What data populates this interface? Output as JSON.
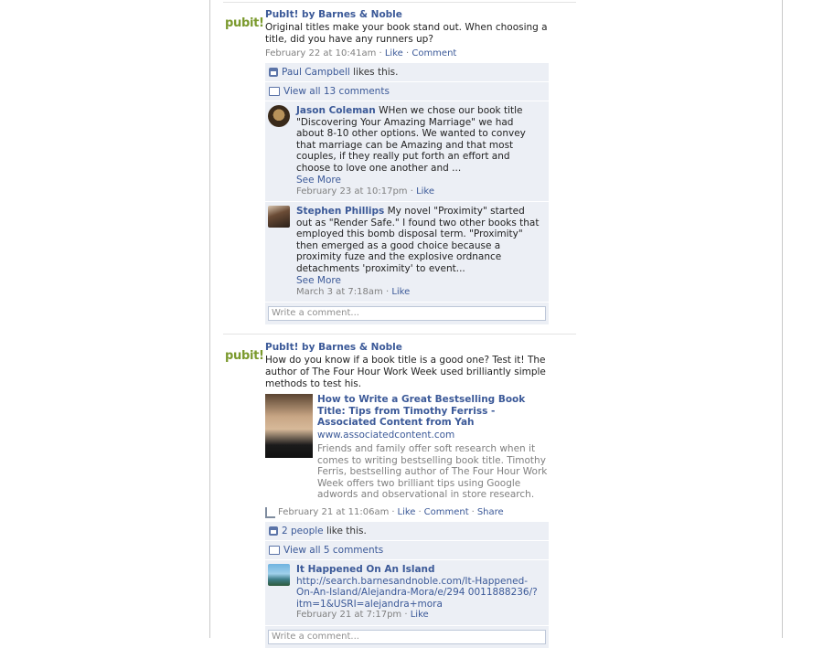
{
  "posts": [
    {
      "author": "PubIt! by Barnes & Noble",
      "logo_text": "pubit!",
      "message": "Original titles make your book stand out. When choosing a title, did you have any runners up?",
      "timestamp": "February 22 at 10:41am",
      "like_label": "Like",
      "comment_label": "Comment",
      "likes_name": "Paul Campbell",
      "likes_suffix": "likes this.",
      "view_all": "View all 13 comments",
      "comments": [
        {
          "name": "Jason Coleman",
          "text": "WHen we chose our book title \"Discovering Your Amazing Marriage\" we had about 8-10 other options. We wanted to convey that marriage can be Amazing and that most couples, if they really put forth an effort and choose to love one another and ...",
          "see_more": "See More",
          "time": "February 23 at 10:17pm",
          "like": "Like"
        },
        {
          "name": "Stephen Phillips",
          "text": "My novel \"Proximity\" started out as \"Render Safe.\" I found two other books that employed this bomb disposal term. \"Proximity\" then emerged as a good choice because a proximity fuze and the explosive ordnance detachments 'proximity' to event...",
          "see_more": "See More",
          "time": "March 3 at 7:18am",
          "like": "Like"
        }
      ],
      "write_placeholder": "Write a comment..."
    },
    {
      "author": "PubIt! by Barnes & Noble",
      "logo_text": "pubit!",
      "message": "How do you know if a book title is a good one? Test it! The author of The Four Hour Work Week used brilliantly simple methods to test his.",
      "attachment": {
        "title": "How to Write a Great Bestselling Book Title: Tips from Timothy Ferriss - Associated Content from Yah",
        "site": "www.associatedcontent.com",
        "description": "Friends and family offer soft research when it comes to writing bestselling book title. Timothy Ferris, bestselling author of The Four Hour Work Week offers two brilliant tips using Google adwords and observational in store research."
      },
      "timestamp": "February 21 at 11:06am",
      "like_label": "Like",
      "comment_label": "Comment",
      "share_label": "Share",
      "likes_count": "2 people",
      "likes_suffix": "like this.",
      "view_all": "View all 5 comments",
      "comments": [
        {
          "name": "It Happened On An Island",
          "url": "http://search.barnesandnoble.com/It-Happened-On-An-Island/Alejandra-Mora/e/294 0011888236/?itm=1&USRI=alejandra+mora",
          "time": "February 21 at 7:17pm",
          "like": "Like"
        }
      ],
      "write_placeholder": "Write a comment..."
    }
  ],
  "colors": {
    "link": "#3b5998",
    "ufi_bg": "#eceff5",
    "meta": "#808080",
    "logo_green": "#7b9a2e",
    "logo_orange": "#e07a1f"
  }
}
